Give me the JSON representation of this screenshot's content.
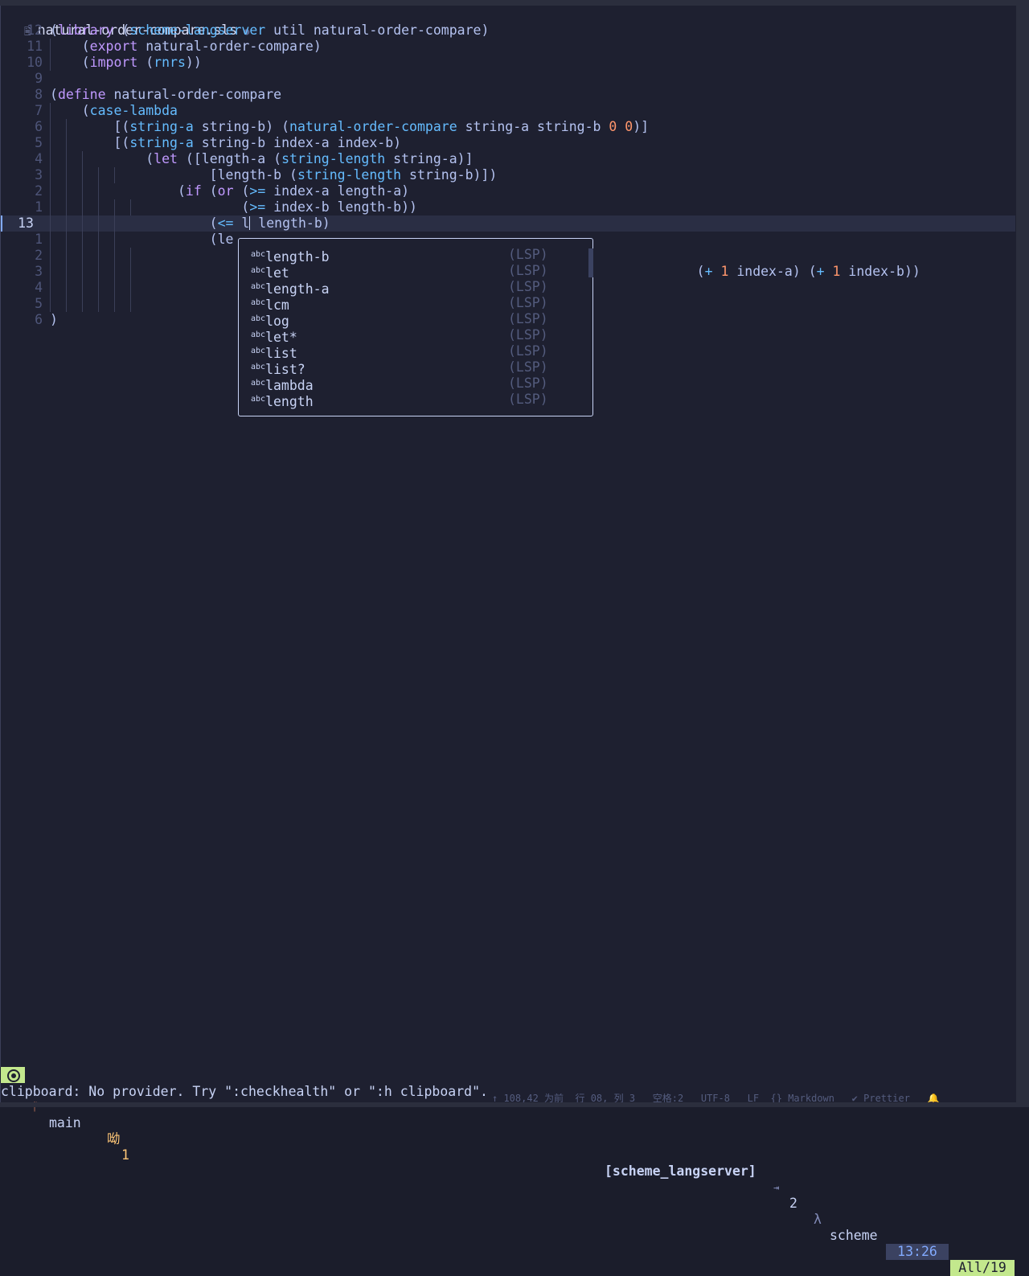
{
  "window": {
    "file_name": "natural-order-compare.sls",
    "modified_indicator": "●"
  },
  "editor": {
    "lines": [
      {
        "num": "12",
        "guides": 0,
        "text": [
          [
            "p",
            "("
          ],
          [
            "kw",
            "library"
          ],
          [
            "p",
            " ("
          ],
          [
            "fn",
            "scheme-langserver"
          ],
          [
            "p",
            " util natural-order-compare)"
          ]
        ]
      },
      {
        "num": "11",
        "guides": 2,
        "text": [
          [
            "p",
            "    ("
          ],
          [
            "kw",
            "export"
          ],
          [
            "p",
            " natural-order-compare)"
          ]
        ]
      },
      {
        "num": "10",
        "guides": 2,
        "text": [
          [
            "p",
            "    ("
          ],
          [
            "kw",
            "import"
          ],
          [
            "p",
            " ("
          ],
          [
            "fn",
            "rnrs"
          ],
          [
            "p",
            "))"
          ]
        ]
      },
      {
        "num": "9",
        "guides": 0,
        "text": []
      },
      {
        "num": "8",
        "guides": 0,
        "text": [
          [
            "p",
            "("
          ],
          [
            "kw",
            "define"
          ],
          [
            "p",
            " natural-order-compare"
          ]
        ]
      },
      {
        "num": "7",
        "guides": 2,
        "text": [
          [
            "p",
            "    ("
          ],
          [
            "fn",
            "case-lambda"
          ]
        ]
      },
      {
        "num": "6",
        "guides": 4,
        "text": [
          [
            "p",
            "        [("
          ],
          [
            "fn",
            "string-a"
          ],
          [
            "p",
            " string-b) ("
          ],
          [
            "fn",
            "natural-order-compare"
          ],
          [
            "p",
            " string-a string-b "
          ],
          [
            "num",
            "0"
          ],
          [
            "p",
            " "
          ],
          [
            "num",
            "0"
          ],
          [
            "p",
            ")]"
          ]
        ]
      },
      {
        "num": "5",
        "guides": 4,
        "text": [
          [
            "p",
            "        [("
          ],
          [
            "fn",
            "string-a"
          ],
          [
            "p",
            " string-b index-a index-b)"
          ]
        ]
      },
      {
        "num": "4",
        "guides": 6,
        "text": [
          [
            "p",
            "            ("
          ],
          [
            "kw",
            "let"
          ],
          [
            "p",
            " ([length-a ("
          ],
          [
            "fn",
            "string-length"
          ],
          [
            "p",
            " string-a)]"
          ]
        ]
      },
      {
        "num": "3",
        "guides": 10,
        "text": [
          [
            "p",
            "                    [length-b ("
          ],
          [
            "fn",
            "string-length"
          ],
          [
            "p",
            " string-b)])"
          ]
        ]
      },
      {
        "num": "2",
        "guides": 8,
        "text": [
          [
            "p",
            "                ("
          ],
          [
            "kw",
            "if"
          ],
          [
            "p",
            " ("
          ],
          [
            "kw",
            "or"
          ],
          [
            "p",
            " ("
          ],
          [
            "fn",
            ">="
          ],
          [
            "p",
            " index-a length-a)"
          ]
        ]
      },
      {
        "num": "1",
        "guides": 12,
        "text": [
          [
            "p",
            "                        ("
          ],
          [
            "fn",
            ">="
          ],
          [
            "p",
            " index-b length-b))"
          ]
        ]
      },
      {
        "num": "13",
        "guides": 10,
        "current": true,
        "text": [
          [
            "p",
            "                    ("
          ],
          [
            "fn",
            "<="
          ],
          [
            "p",
            " l"
          ],
          [
            "caret",
            ""
          ],
          [
            "p",
            " length-b)"
          ]
        ]
      },
      {
        "num": "1",
        "guides": 10,
        "text": [
          [
            "p",
            "                    (le"
          ]
        ]
      },
      {
        "num": "2",
        "guides": 12,
        "text": []
      },
      {
        "num": "3",
        "guides": 12,
        "text": [
          [
            "pad",
            "                                                                             "
          ],
          [
            "p",
            "    ("
          ],
          [
            "fn",
            "+"
          ],
          [
            "p",
            " "
          ],
          [
            "num",
            "1"
          ],
          [
            "p",
            " index-a) ("
          ],
          [
            "fn",
            "+"
          ],
          [
            "p",
            " "
          ],
          [
            "num",
            "1"
          ],
          [
            "p",
            " index-b))"
          ]
        ],
        "tail_only": true
      },
      {
        "num": "4",
        "guides": 12,
        "text": [
          [
            "p",
            "                                                                                  (+ 1 index-a) (+ 1 index-b))"
          ]
        ],
        "hidden_by_popup": true
      },
      {
        "num": "5",
        "guides": 12,
        "text": []
      },
      {
        "num": "6",
        "guides": 0,
        "text": [
          [
            "p",
            ")"
          ]
        ]
      }
    ],
    "overflow_tail": "(+ 1 index-a) (+ 1 index-b))"
  },
  "completion": {
    "items": [
      {
        "kind": "abc",
        "label": "length-b",
        "source": "(LSP)"
      },
      {
        "kind": "abc",
        "label": "let",
        "source": "(LSP)"
      },
      {
        "kind": "abc",
        "label": "length-a",
        "source": "(LSP)"
      },
      {
        "kind": "abc",
        "label": "lcm",
        "source": "(LSP)"
      },
      {
        "kind": "abc",
        "label": "log",
        "source": "(LSP)"
      },
      {
        "kind": "abc",
        "label": "let*",
        "source": "(LSP)"
      },
      {
        "kind": "abc",
        "label": "list",
        "source": "(LSP)"
      },
      {
        "kind": "abc",
        "label": "list?",
        "source": "(LSP)"
      },
      {
        "kind": "abc",
        "label": "lambda",
        "source": "(LSP)"
      },
      {
        "kind": "abc",
        "label": "length",
        "source": "(LSP)"
      }
    ]
  },
  "statusline": {
    "mode_icon": "neovim-icon",
    "branch_icon": "git-branch-icon",
    "branch": "main",
    "diagnostics_icon": "warning-icon",
    "diagnostics_count": "1",
    "diagnostics_glyph": "呦",
    "lsp": "[scheme_langserver]",
    "indent_icon": "⇥",
    "indent": "2",
    "filetype_icon": "λ",
    "filetype": "scheme",
    "position": "13:26",
    "progress": "All/19"
  },
  "cmdline": {
    "message": "clipboard: No provider. Try \":checkhealth\" or \":h clipboard\"."
  },
  "ghost_statusbar": {
    "text": "↑ 108,42 为前  行 08, 列 3   空格:2   UTF-8   LF  {} Markdown   ✔ Prettier   🔔"
  },
  "colors": {
    "background": "#1e2030",
    "keyword": "#c099ff",
    "function": "#65bcff",
    "number": "#ff966c",
    "mode_accent": "#c3e88d",
    "position_bg": "#3b4261"
  }
}
